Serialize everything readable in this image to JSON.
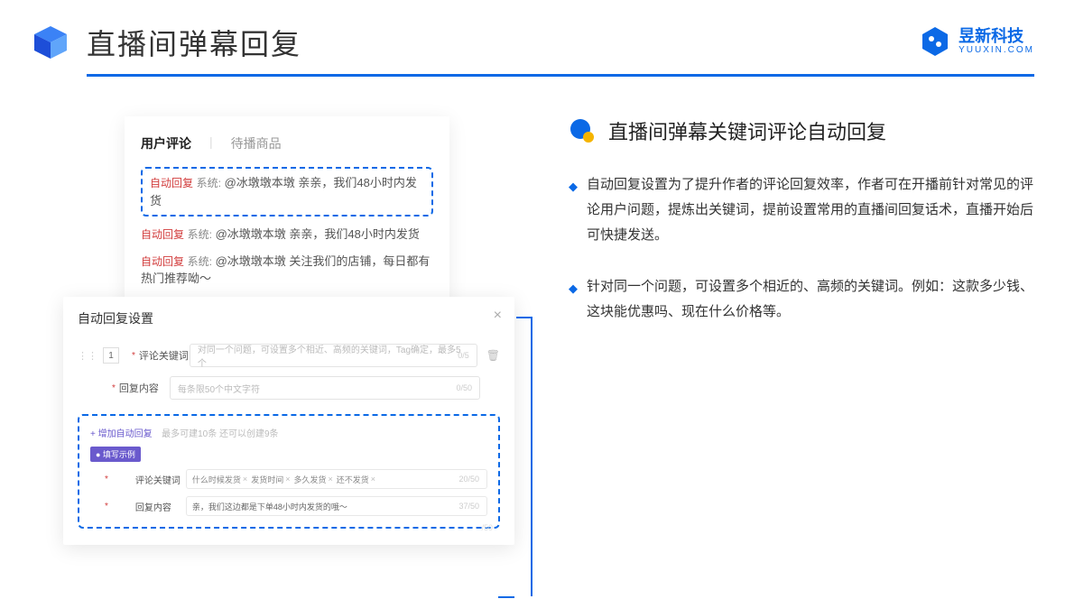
{
  "header": {
    "title": "直播间弹幕回复"
  },
  "brand": {
    "name": "昱新科技",
    "url": "YUUXIN.COM"
  },
  "comments": {
    "tab_active": "用户评论",
    "tab_inactive": "待播商品",
    "items": [
      {
        "tag": "自动回复",
        "sys": "系统:",
        "text": "@冰墩墩本墩 亲亲，我们48小时内发货"
      },
      {
        "tag": "自动回复",
        "sys": "系统:",
        "text": "@冰墩墩本墩 亲亲，我们48小时内发货"
      },
      {
        "tag": "自动回复",
        "sys": "系统:",
        "text": "@冰墩墩本墩 关注我们的店铺，每日都有热门推荐呦～"
      }
    ]
  },
  "modal": {
    "title": "自动回复设置",
    "index": "1",
    "kw_label": "评论关键词",
    "kw_placeholder": "对同一个问题，可设置多个相近、高频的关键词，Tag确定，最多5个",
    "kw_count": "0/5",
    "content_label": "回复内容",
    "content_placeholder": "每条限50个中文字符",
    "content_count": "0/50",
    "add_link": "+ 增加自动回复",
    "add_hint": "最多可建10条 还可以创建9条",
    "example_badge": "● 填写示例",
    "ex_kw_label": "评论关键词",
    "ex_tags": [
      "什么时候发货",
      "发货时间",
      "多久发货",
      "还不发货"
    ],
    "ex_kw_count": "20/50",
    "ex_content_label": "回复内容",
    "ex_content_value": "亲，我们这边都是下单48小时内发货的哦～",
    "ex_content_count": "37/50",
    "faded": "/50"
  },
  "section": {
    "title": "直播间弹幕关键词评论自动回复",
    "bullets": [
      "自动回复设置为了提升作者的评论回复效率，作者可在开播前针对常见的评论用户问题，提炼出关键词，提前设置常用的直播间回复话术，直播开始后可快捷发送。",
      "针对同一个问题，可设置多个相近的、高频的关键词。例如：这款多少钱、这块能优惠吗、现在什么价格等。"
    ]
  }
}
